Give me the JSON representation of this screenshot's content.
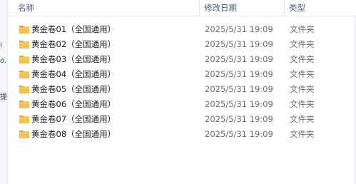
{
  "left_fragments": [
    "i",
    "o.",
    "提"
  ],
  "columns": {
    "name": "名称",
    "date_modified": "修改日期",
    "type": "类型"
  },
  "files": [
    {
      "name": "黄金卷01（全国通用）",
      "date": "2025/5/31 19:09",
      "type": "文件夹",
      "icon": "folder-icon"
    },
    {
      "name": "黄金卷02（全国通用）",
      "date": "2025/5/31 19:09",
      "type": "文件夹",
      "icon": "folder-icon"
    },
    {
      "name": "黄金卷03（全国通用）",
      "date": "2025/5/31 19:09",
      "type": "文件夹",
      "icon": "folder-icon"
    },
    {
      "name": "黄金卷04（全国通用）",
      "date": "2025/5/31 19:09",
      "type": "文件夹",
      "icon": "folder-icon"
    },
    {
      "name": "黄金卷05（全国通用）",
      "date": "2025/5/31 19:09",
      "type": "文件夹",
      "icon": "folder-icon"
    },
    {
      "name": "黄金卷06（全国通用）",
      "date": "2025/5/31 19:09",
      "type": "文件夹",
      "icon": "folder-icon"
    },
    {
      "name": "黄金卷07（全国通用）",
      "date": "2025/5/31 19:09",
      "type": "文件夹",
      "icon": "folder-icon"
    },
    {
      "name": "黄金卷08（全国通用）",
      "date": "2025/5/31 19:09",
      "type": "文件夹",
      "icon": "folder-icon"
    }
  ],
  "colors": {
    "folder_body": "#f2c14e",
    "folder_back": "#dca43a",
    "header_text": "#4c607a",
    "secondary_text": "#6d6d6d"
  }
}
